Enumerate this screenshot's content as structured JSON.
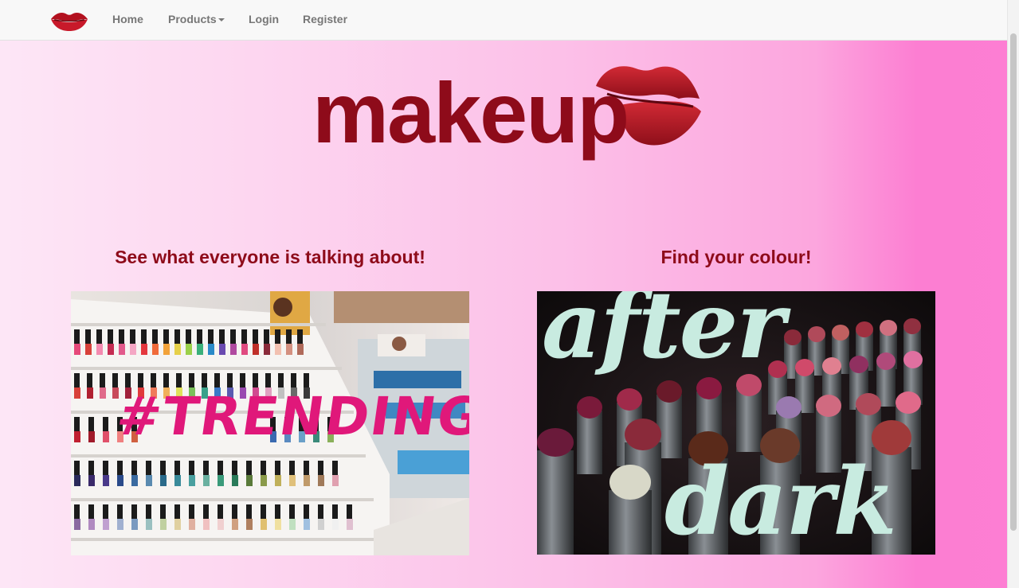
{
  "nav": {
    "brand_icon": "lips-icon",
    "items": [
      {
        "label": "Home"
      },
      {
        "label": "Products",
        "has_dropdown": true
      },
      {
        "label": "Login"
      },
      {
        "label": "Register"
      }
    ]
  },
  "hero": {
    "logo_text": "makeup",
    "logo_icon": "lips-icon"
  },
  "sections": [
    {
      "heading": "See what everyone is talking about!",
      "image_caption": "#TRENDING"
    },
    {
      "heading": "Find your colour!",
      "image_caption_top": "after",
      "image_caption_bottom": "dark"
    }
  ],
  "colors": {
    "brand_red": "#8e0b1a",
    "accent_pink": "#e8167a",
    "mint": "#c8ebe0"
  }
}
